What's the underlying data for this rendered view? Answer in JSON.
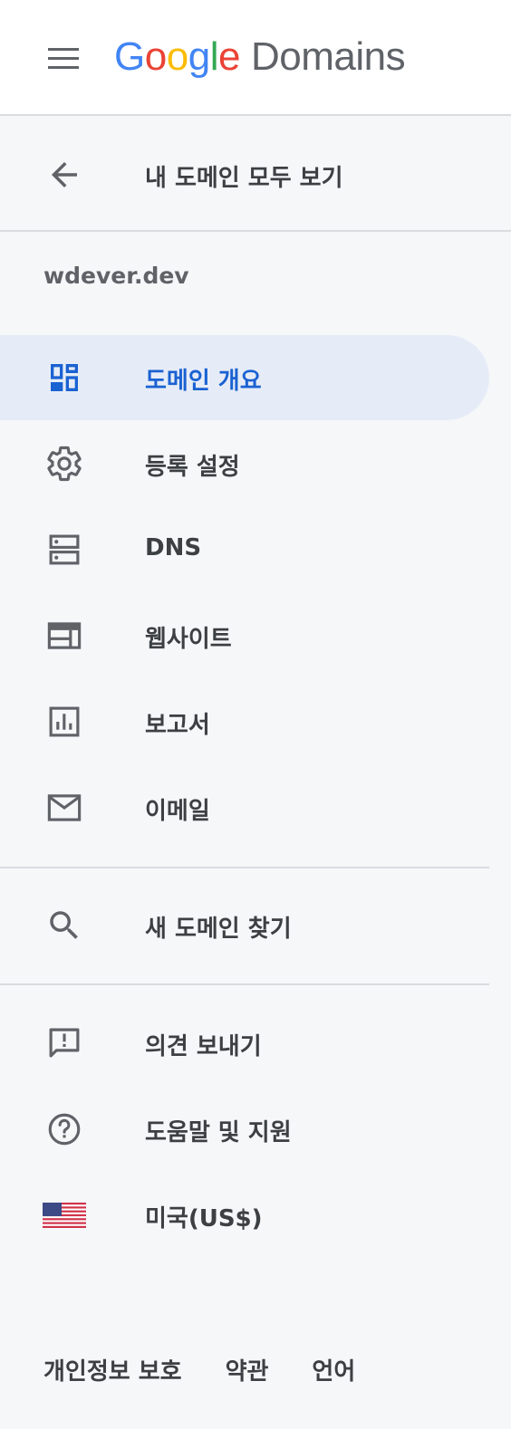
{
  "header": {
    "menu_icon": "hamburger-menu-icon",
    "logo": {
      "google_letters": [
        {
          "char": "G",
          "color": "#4285f4"
        },
        {
          "char": "o",
          "color": "#ea4335"
        },
        {
          "char": "o",
          "color": "#fbbc05"
        },
        {
          "char": "g",
          "color": "#4285f4"
        },
        {
          "char": "l",
          "color": "#34a853"
        },
        {
          "char": "e",
          "color": "#ea4335"
        }
      ],
      "product": "Domains"
    }
  },
  "sidebar": {
    "back": {
      "label": "내 도메인 모두 보기",
      "icon": "arrow-back-icon"
    },
    "domain_name": "wdever.dev",
    "items": [
      {
        "label": "도메인 개요",
        "icon": "dashboard-icon",
        "active": true
      },
      {
        "label": "등록 설정",
        "icon": "gear-icon",
        "active": false
      },
      {
        "label": "DNS",
        "icon": "dns-icon",
        "active": false
      },
      {
        "label": "웹사이트",
        "icon": "website-icon",
        "active": false
      },
      {
        "label": "보고서",
        "icon": "report-chart-icon",
        "active": false
      },
      {
        "label": "이메일",
        "icon": "email-icon",
        "active": false
      }
    ],
    "search": {
      "label": "새 도메인 찾기",
      "icon": "search-icon"
    },
    "secondary": [
      {
        "label": "의견 보내기",
        "icon": "feedback-icon"
      },
      {
        "label": "도움말 및 지원",
        "icon": "help-icon"
      },
      {
        "label": "미국(US$)",
        "icon": "us-flag-icon"
      }
    ]
  },
  "footer": {
    "privacy": "개인정보 보호",
    "terms": "약관",
    "language": "언어"
  },
  "colors": {
    "accent": "#1a62d2",
    "active_bg": "#e6ecf7",
    "icon": "#5f6368",
    "background": "#f6f7f9"
  }
}
